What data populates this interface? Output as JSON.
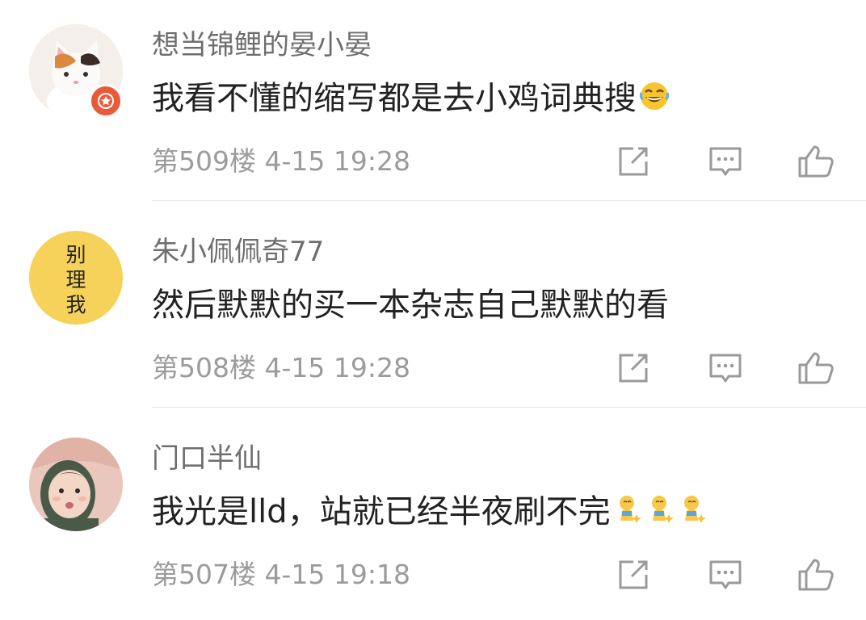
{
  "comments": [
    {
      "username": "想当锦鲤的晏小晏",
      "text": "我看不懂的缩写都是去小鸡词典搜",
      "meta": "第509楼 4-15 19:28",
      "avatar_icon": "cat-photo",
      "emoji": "laughing-tears-emoji"
    },
    {
      "username": "朱小佩佩奇77",
      "text": "然后默默的买一本杂志自己默默的看",
      "meta": "第508楼 4-15 19:28",
      "avatar_icon": "text-avatar",
      "avatar_text": [
        "别",
        "理",
        "我"
      ]
    },
    {
      "username": "门口半仙",
      "text": "我光是lld，站就已经半夜刷不完",
      "meta": "第507楼 4-15 19:18",
      "avatar_icon": "baby-photo",
      "emoji": "kneeling-emoji"
    }
  ],
  "actions": [
    "share-icon",
    "comment-icon",
    "like-icon"
  ],
  "colors": {
    "username": "#6e6e6e",
    "content": "#222222",
    "meta": "#9b9b9b",
    "divider": "#e8e8e8",
    "avatar_yellow": "#f6d25a",
    "badge_red": "#e85a3a"
  }
}
